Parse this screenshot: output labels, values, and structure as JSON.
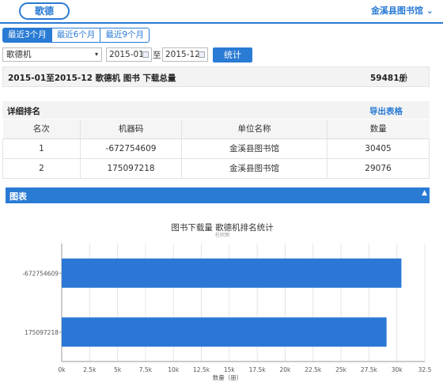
{
  "header": {
    "brand_label": "歌德",
    "library_menu_label": "金溪县图书馆",
    "library_menu_arrow": "⌄"
  },
  "tabs": [
    {
      "label": "最近3个月",
      "active": true
    },
    {
      "label": "最近6个月",
      "active": false
    },
    {
      "label": "最近9个月",
      "active": false
    }
  ],
  "filters": {
    "device_select": "歌德机",
    "select_arrow": "▾",
    "start_date": "2015-01",
    "to_label": "至",
    "end_date": "2015-12",
    "stats_button": "统计"
  },
  "summary": {
    "title": "2015-01至2015-12 歌德机 图书 下载总量",
    "total": "59481册"
  },
  "detail": {
    "title": "详细排名",
    "export_label": "导出表格",
    "columns": [
      "名次",
      "机器码",
      "单位名称",
      "数量"
    ],
    "rows": [
      {
        "rank": "1",
        "code": "-672754609",
        "unit": "金溪县图书馆",
        "count": "30405"
      },
      {
        "rank": "2",
        "code": "175097218",
        "unit": "金溪县图书馆",
        "count": "29076"
      }
    ]
  },
  "chart_section": {
    "title": "图表",
    "collapse_icon": "▲"
  },
  "colors": {
    "accent": "#2a7bd4",
    "bar": "#2a77d6"
  },
  "chart_data": {
    "type": "bar",
    "orientation": "horizontal",
    "title": "图书下载量 歌德机排名统计",
    "subtitle": "柱状图",
    "categories": [
      "-672754609",
      "175097218"
    ],
    "values": [
      30405,
      29076
    ],
    "xlim": [
      0,
      32500
    ],
    "xticks": [
      "0k",
      "2.5k",
      "5k",
      "7.5k",
      "10k",
      "12.5k",
      "15k",
      "17.5k",
      "20k",
      "22.5k",
      "25k",
      "27.5k",
      "30k",
      "32.5"
    ],
    "xlabel": "数量（册）",
    "grid": true
  }
}
